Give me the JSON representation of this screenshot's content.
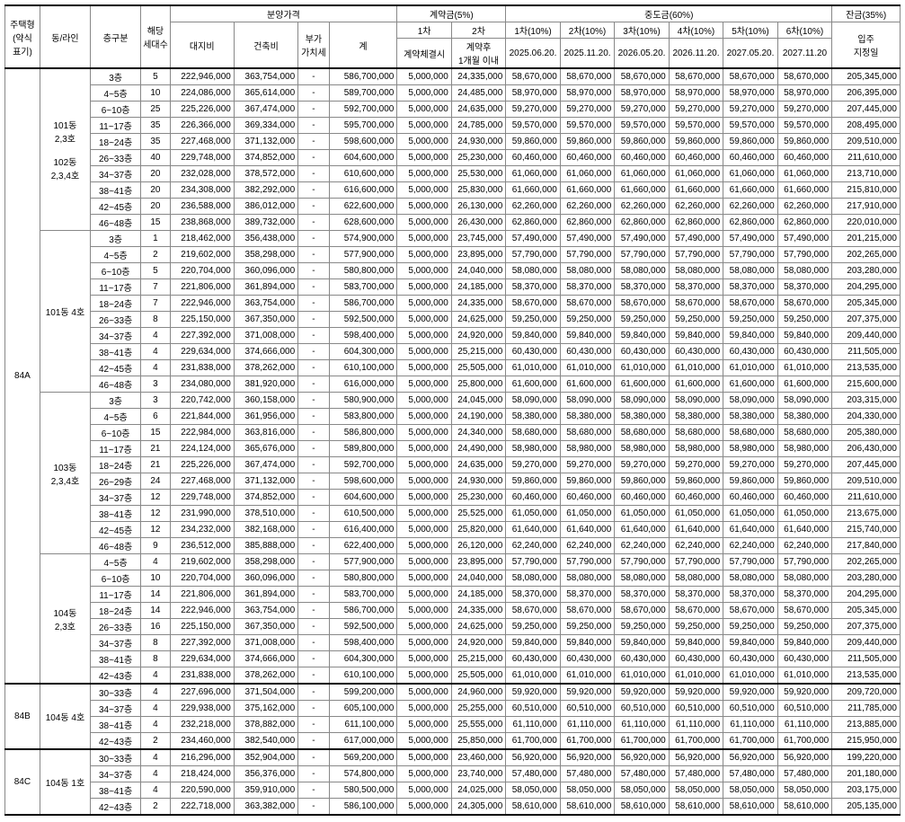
{
  "headers": {
    "type": "주택형\n(약식\n표기)",
    "dong": "동/라인",
    "floor": "층구분",
    "households": "해당\n세대수",
    "priceGroup": "분양가격",
    "land": "대지비",
    "build": "건축비",
    "vat": "부가\n가치세",
    "total": "계",
    "contractGroup": "계약금(5%)",
    "c1": "1차",
    "c2": "2차",
    "c1sub": "계약체결시",
    "c2sub": "계약후\n1개월 이내",
    "midGroup": "중도금(60%)",
    "m1": "1차(10%)",
    "m2": "2차(10%)",
    "m3": "3차(10%)",
    "m4": "4차(10%)",
    "m5": "5차(10%)",
    "m6": "6차(10%)",
    "d1": "2025.06.20.",
    "d2": "2025.11.20.",
    "d3": "2026.05.20.",
    "d4": "2026.11.20.",
    "d5": "2027.05.20.",
    "d6": "2027.11.20",
    "balanceGroup": "잔금(35%)",
    "movein": "입주\n지정일"
  },
  "groups": [
    {
      "type": "84A",
      "blocks": [
        {
          "dong": "101동\n2,3호\n\n102동\n2,3,4호",
          "rows": [
            {
              "f": "3층",
              "h": "5",
              "l": "222,946,000",
              "b": "363,754,000",
              "v": "-",
              "t": "586,700,000",
              "c1": "5,000,000",
              "c2": "24,335,000",
              "m": "58,670,000",
              "bal": "205,345,000"
            },
            {
              "f": "4~5층",
              "h": "10",
              "l": "224,086,000",
              "b": "365,614,000",
              "v": "-",
              "t": "589,700,000",
              "c1": "5,000,000",
              "c2": "24,485,000",
              "m": "58,970,000",
              "bal": "206,395,000"
            },
            {
              "f": "6~10층",
              "h": "25",
              "l": "225,226,000",
              "b": "367,474,000",
              "v": "-",
              "t": "592,700,000",
              "c1": "5,000,000",
              "c2": "24,635,000",
              "m": "59,270,000",
              "bal": "207,445,000"
            },
            {
              "f": "11~17층",
              "h": "35",
              "l": "226,366,000",
              "b": "369,334,000",
              "v": "-",
              "t": "595,700,000",
              "c1": "5,000,000",
              "c2": "24,785,000",
              "m": "59,570,000",
              "bal": "208,495,000"
            },
            {
              "f": "18~24층",
              "h": "35",
              "l": "227,468,000",
              "b": "371,132,000",
              "v": "-",
              "t": "598,600,000",
              "c1": "5,000,000",
              "c2": "24,930,000",
              "m": "59,860,000",
              "bal": "209,510,000"
            },
            {
              "f": "26~33층",
              "h": "40",
              "l": "229,748,000",
              "b": "374,852,000",
              "v": "-",
              "t": "604,600,000",
              "c1": "5,000,000",
              "c2": "25,230,000",
              "m": "60,460,000",
              "bal": "211,610,000"
            },
            {
              "f": "34~37층",
              "h": "20",
              "l": "232,028,000",
              "b": "378,572,000",
              "v": "-",
              "t": "610,600,000",
              "c1": "5,000,000",
              "c2": "25,530,000",
              "m": "61,060,000",
              "bal": "213,710,000"
            },
            {
              "f": "38~41층",
              "h": "20",
              "l": "234,308,000",
              "b": "382,292,000",
              "v": "-",
              "t": "616,600,000",
              "c1": "5,000,000",
              "c2": "25,830,000",
              "m": "61,660,000",
              "bal": "215,810,000"
            },
            {
              "f": "42~45층",
              "h": "20",
              "l": "236,588,000",
              "b": "386,012,000",
              "v": "-",
              "t": "622,600,000",
              "c1": "5,000,000",
              "c2": "26,130,000",
              "m": "62,260,000",
              "bal": "217,910,000"
            },
            {
              "f": "46~48층",
              "h": "15",
              "l": "238,868,000",
              "b": "389,732,000",
              "v": "-",
              "t": "628,600,000",
              "c1": "5,000,000",
              "c2": "26,430,000",
              "m": "62,860,000",
              "bal": "220,010,000"
            }
          ]
        },
        {
          "dong": "101동 4호",
          "rows": [
            {
              "f": "3층",
              "h": "1",
              "l": "218,462,000",
              "b": "356,438,000",
              "v": "-",
              "t": "574,900,000",
              "c1": "5,000,000",
              "c2": "23,745,000",
              "m": "57,490,000",
              "bal": "201,215,000"
            },
            {
              "f": "4~5층",
              "h": "2",
              "l": "219,602,000",
              "b": "358,298,000",
              "v": "-",
              "t": "577,900,000",
              "c1": "5,000,000",
              "c2": "23,895,000",
              "m": "57,790,000",
              "bal": "202,265,000"
            },
            {
              "f": "6~10층",
              "h": "5",
              "l": "220,704,000",
              "b": "360,096,000",
              "v": "-",
              "t": "580,800,000",
              "c1": "5,000,000",
              "c2": "24,040,000",
              "m": "58,080,000",
              "bal": "203,280,000"
            },
            {
              "f": "11~17층",
              "h": "7",
              "l": "221,806,000",
              "b": "361,894,000",
              "v": "-",
              "t": "583,700,000",
              "c1": "5,000,000",
              "c2": "24,185,000",
              "m": "58,370,000",
              "bal": "204,295,000"
            },
            {
              "f": "18~24층",
              "h": "7",
              "l": "222,946,000",
              "b": "363,754,000",
              "v": "-",
              "t": "586,700,000",
              "c1": "5,000,000",
              "c2": "24,335,000",
              "m": "58,670,000",
              "bal": "205,345,000"
            },
            {
              "f": "26~33층",
              "h": "8",
              "l": "225,150,000",
              "b": "367,350,000",
              "v": "-",
              "t": "592,500,000",
              "c1": "5,000,000",
              "c2": "24,625,000",
              "m": "59,250,000",
              "bal": "207,375,000"
            },
            {
              "f": "34~37층",
              "h": "4",
              "l": "227,392,000",
              "b": "371,008,000",
              "v": "-",
              "t": "598,400,000",
              "c1": "5,000,000",
              "c2": "24,920,000",
              "m": "59,840,000",
              "bal": "209,440,000"
            },
            {
              "f": "38~41층",
              "h": "4",
              "l": "229,634,000",
              "b": "374,666,000",
              "v": "-",
              "t": "604,300,000",
              "c1": "5,000,000",
              "c2": "25,215,000",
              "m": "60,430,000",
              "bal": "211,505,000"
            },
            {
              "f": "42~45층",
              "h": "4",
              "l": "231,838,000",
              "b": "378,262,000",
              "v": "-",
              "t": "610,100,000",
              "c1": "5,000,000",
              "c2": "25,505,000",
              "m": "61,010,000",
              "bal": "213,535,000"
            },
            {
              "f": "46~48층",
              "h": "3",
              "l": "234,080,000",
              "b": "381,920,000",
              "v": "-",
              "t": "616,000,000",
              "c1": "5,000,000",
              "c2": "25,800,000",
              "m": "61,600,000",
              "bal": "215,600,000"
            }
          ]
        },
        {
          "dong": "103동\n2,3,4호",
          "rows": [
            {
              "f": "3층",
              "h": "3",
              "l": "220,742,000",
              "b": "360,158,000",
              "v": "-",
              "t": "580,900,000",
              "c1": "5,000,000",
              "c2": "24,045,000",
              "m": "58,090,000",
              "bal": "203,315,000"
            },
            {
              "f": "4~5층",
              "h": "6",
              "l": "221,844,000",
              "b": "361,956,000",
              "v": "-",
              "t": "583,800,000",
              "c1": "5,000,000",
              "c2": "24,190,000",
              "m": "58,380,000",
              "bal": "204,330,000"
            },
            {
              "f": "6~10층",
              "h": "15",
              "l": "222,984,000",
              "b": "363,816,000",
              "v": "-",
              "t": "586,800,000",
              "c1": "5,000,000",
              "c2": "24,340,000",
              "m": "58,680,000",
              "bal": "205,380,000"
            },
            {
              "f": "11~17층",
              "h": "21",
              "l": "224,124,000",
              "b": "365,676,000",
              "v": "-",
              "t": "589,800,000",
              "c1": "5,000,000",
              "c2": "24,490,000",
              "m": "58,980,000",
              "bal": "206,430,000"
            },
            {
              "f": "18~24층",
              "h": "21",
              "l": "225,226,000",
              "b": "367,474,000",
              "v": "-",
              "t": "592,700,000",
              "c1": "5,000,000",
              "c2": "24,635,000",
              "m": "59,270,000",
              "bal": "207,445,000"
            },
            {
              "f": "26~29층",
              "h": "24",
              "l": "227,468,000",
              "b": "371,132,000",
              "v": "-",
              "t": "598,600,000",
              "c1": "5,000,000",
              "c2": "24,930,000",
              "m": "59,860,000",
              "bal": "209,510,000"
            },
            {
              "f": "34~37층",
              "h": "12",
              "l": "229,748,000",
              "b": "374,852,000",
              "v": "-",
              "t": "604,600,000",
              "c1": "5,000,000",
              "c2": "25,230,000",
              "m": "60,460,000",
              "bal": "211,610,000"
            },
            {
              "f": "38~41층",
              "h": "12",
              "l": "231,990,000",
              "b": "378,510,000",
              "v": "-",
              "t": "610,500,000",
              "c1": "5,000,000",
              "c2": "25,525,000",
              "m": "61,050,000",
              "bal": "213,675,000"
            },
            {
              "f": "42~45층",
              "h": "12",
              "l": "234,232,000",
              "b": "382,168,000",
              "v": "-",
              "t": "616,400,000",
              "c1": "5,000,000",
              "c2": "25,820,000",
              "m": "61,640,000",
              "bal": "215,740,000"
            },
            {
              "f": "46~48층",
              "h": "9",
              "l": "236,512,000",
              "b": "385,888,000",
              "v": "-",
              "t": "622,400,000",
              "c1": "5,000,000",
              "c2": "26,120,000",
              "m": "62,240,000",
              "bal": "217,840,000"
            }
          ]
        },
        {
          "dong": "104동\n2,3호",
          "rows": [
            {
              "f": "4~5층",
              "h": "4",
              "l": "219,602,000",
              "b": "358,298,000",
              "v": "-",
              "t": "577,900,000",
              "c1": "5,000,000",
              "c2": "23,895,000",
              "m": "57,790,000",
              "bal": "202,265,000"
            },
            {
              "f": "6~10층",
              "h": "10",
              "l": "220,704,000",
              "b": "360,096,000",
              "v": "-",
              "t": "580,800,000",
              "c1": "5,000,000",
              "c2": "24,040,000",
              "m": "58,080,000",
              "bal": "203,280,000"
            },
            {
              "f": "11~17층",
              "h": "14",
              "l": "221,806,000",
              "b": "361,894,000",
              "v": "-",
              "t": "583,700,000",
              "c1": "5,000,000",
              "c2": "24,185,000",
              "m": "58,370,000",
              "bal": "204,295,000"
            },
            {
              "f": "18~24층",
              "h": "14",
              "l": "222,946,000",
              "b": "363,754,000",
              "v": "-",
              "t": "586,700,000",
              "c1": "5,000,000",
              "c2": "24,335,000",
              "m": "58,670,000",
              "bal": "205,345,000"
            },
            {
              "f": "26~33층",
              "h": "16",
              "l": "225,150,000",
              "b": "367,350,000",
              "v": "-",
              "t": "592,500,000",
              "c1": "5,000,000",
              "c2": "24,625,000",
              "m": "59,250,000",
              "bal": "207,375,000"
            },
            {
              "f": "34~37층",
              "h": "8",
              "l": "227,392,000",
              "b": "371,008,000",
              "v": "-",
              "t": "598,400,000",
              "c1": "5,000,000",
              "c2": "24,920,000",
              "m": "59,840,000",
              "bal": "209,440,000"
            },
            {
              "f": "38~41층",
              "h": "8",
              "l": "229,634,000",
              "b": "374,666,000",
              "v": "-",
              "t": "604,300,000",
              "c1": "5,000,000",
              "c2": "25,215,000",
              "m": "60,430,000",
              "bal": "211,505,000"
            },
            {
              "f": "42~43층",
              "h": "4",
              "l": "231,838,000",
              "b": "378,262,000",
              "v": "-",
              "t": "610,100,000",
              "c1": "5,000,000",
              "c2": "25,505,000",
              "m": "61,010,000",
              "bal": "213,535,000"
            }
          ]
        }
      ]
    },
    {
      "type": "84B",
      "blocks": [
        {
          "dong": "104동 4호",
          "rows": [
            {
              "f": "30~33층",
              "h": "4",
              "l": "227,696,000",
              "b": "371,504,000",
              "v": "-",
              "t": "599,200,000",
              "c1": "5,000,000",
              "c2": "24,960,000",
              "m": "59,920,000",
              "bal": "209,720,000"
            },
            {
              "f": "34~37층",
              "h": "4",
              "l": "229,938,000",
              "b": "375,162,000",
              "v": "-",
              "t": "605,100,000",
              "c1": "5,000,000",
              "c2": "25,255,000",
              "m": "60,510,000",
              "bal": "211,785,000"
            },
            {
              "f": "38~41층",
              "h": "4",
              "l": "232,218,000",
              "b": "378,882,000",
              "v": "-",
              "t": "611,100,000",
              "c1": "5,000,000",
              "c2": "25,555,000",
              "m": "61,110,000",
              "bal": "213,885,000"
            },
            {
              "f": "42~43층",
              "h": "2",
              "l": "234,460,000",
              "b": "382,540,000",
              "v": "-",
              "t": "617,000,000",
              "c1": "5,000,000",
              "c2": "25,850,000",
              "m": "61,700,000",
              "bal": "215,950,000"
            }
          ]
        }
      ]
    },
    {
      "type": "84C",
      "blocks": [
        {
          "dong": "104동 1호",
          "rows": [
            {
              "f": "30~33층",
              "h": "4",
              "l": "216,296,000",
              "b": "352,904,000",
              "v": "-",
              "t": "569,200,000",
              "c1": "5,000,000",
              "c2": "23,460,000",
              "m": "56,920,000",
              "bal": "199,220,000"
            },
            {
              "f": "34~37층",
              "h": "4",
              "l": "218,424,000",
              "b": "356,376,000",
              "v": "-",
              "t": "574,800,000",
              "c1": "5,000,000",
              "c2": "23,740,000",
              "m": "57,480,000",
              "bal": "201,180,000"
            },
            {
              "f": "38~41층",
              "h": "4",
              "l": "220,590,000",
              "b": "359,910,000",
              "v": "-",
              "t": "580,500,000",
              "c1": "5,000,000",
              "c2": "24,025,000",
              "m": "58,050,000",
              "bal": "203,175,000"
            },
            {
              "f": "42~43층",
              "h": "2",
              "l": "222,718,000",
              "b": "363,382,000",
              "v": "-",
              "t": "586,100,000",
              "c1": "5,000,000",
              "c2": "24,305,000",
              "m": "58,610,000",
              "bal": "205,135,000"
            }
          ]
        }
      ]
    }
  ]
}
